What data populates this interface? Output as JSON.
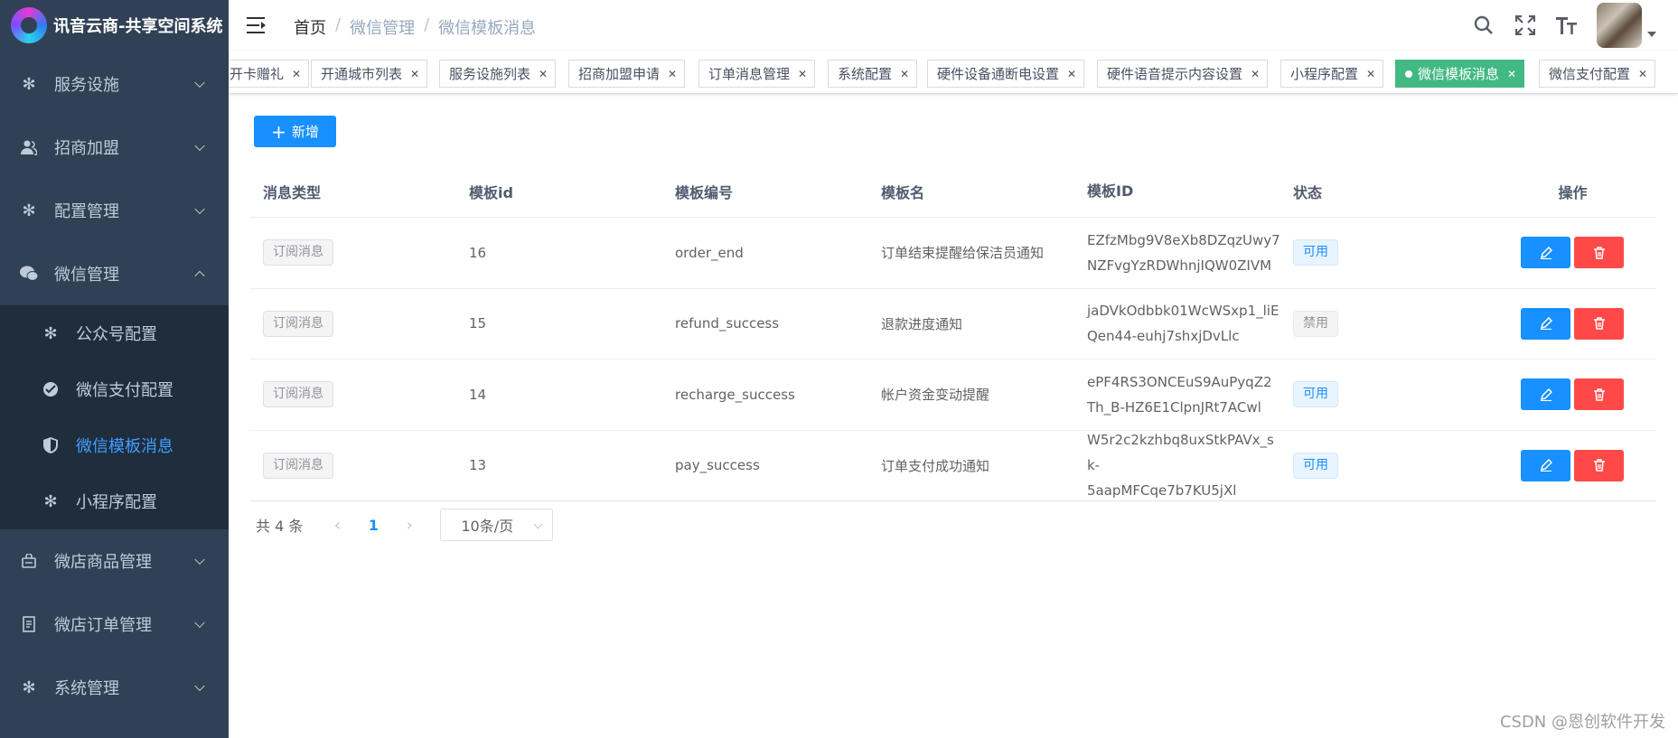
{
  "app": {
    "title": "讯音云商-共享空间系统"
  },
  "sidebar": {
    "items": [
      {
        "label": "服务设施",
        "icon": "gear-icon",
        "expanded": false
      },
      {
        "label": "招商加盟",
        "icon": "user-icon",
        "expanded": false
      },
      {
        "label": "配置管理",
        "icon": "gear-icon",
        "expanded": false
      },
      {
        "label": "微信管理",
        "icon": "wechat-icon",
        "expanded": true
      },
      {
        "label": "微店商品管理",
        "icon": "store-icon",
        "expanded": false
      },
      {
        "label": "微店订单管理",
        "icon": "order-icon",
        "expanded": false
      },
      {
        "label": "系统管理",
        "icon": "gear-icon",
        "expanded": false
      }
    ],
    "sub_items": [
      {
        "label": "公众号配置",
        "icon": "gear-icon"
      },
      {
        "label": "微信支付配置",
        "icon": "pay-icon"
      },
      {
        "label": "微信模板消息",
        "icon": "shield-icon",
        "active": true
      },
      {
        "label": "小程序配置",
        "icon": "gear-icon"
      }
    ]
  },
  "header": {
    "breadcrumb": [
      "首页",
      "微信管理",
      "微信模板消息"
    ]
  },
  "tags": [
    "开卡赠礼",
    "开通城市列表",
    "服务设施列表",
    "招商加盟申请",
    "订单消息管理",
    "系统配置",
    "硬件设备通断电设置",
    "硬件语音提示内容设置",
    "小程序配置",
    "微信模板消息",
    "微信支付配置"
  ],
  "active_tag": "微信模板消息",
  "toolbar": {
    "add_label": "新增"
  },
  "table": {
    "columns": [
      "消息类型",
      "模板id",
      "模板编号",
      "模板名",
      "模板ID",
      "状态",
      "操作"
    ],
    "rows": [
      {
        "type": "订阅消息",
        "id": "16",
        "code": "order_end",
        "name": "订单结束提醒给保洁员通知",
        "template_id": "EZfzMbg9V8eXb8DZqzUwy7NZFvgYzRDWhnjIQW0ZIVM",
        "tid1": "EZfzMbg9V8eXb8DZqzUwy7",
        "tid2": "NZFvgYzRDWhnjIQW0ZIVM",
        "status": "可用"
      },
      {
        "type": "订阅消息",
        "id": "15",
        "code": "refund_success",
        "name": "退款进度通知",
        "template_id": "jaDVkOdbbk01WcWSxp1_liEQen44-euhj7shxjDvLlc",
        "tid1": "jaDVkOdbbk01WcWSxp1_liE",
        "tid2": "Qen44-euhj7shxjDvLlc",
        "status": "禁用"
      },
      {
        "type": "订阅消息",
        "id": "14",
        "code": "recharge_success",
        "name": "帐户资金变动提醒",
        "template_id": "ePF4RS3ONCEuS9AuPyqZ2Th_B-HZ6E1ClpnJRt7ACwl",
        "tid1": "ePF4RS3ONCEuS9AuPyqZ2",
        "tid2": "Th_B-HZ6E1ClpnJRt7ACwl",
        "status": "可用"
      },
      {
        "type": "订阅消息",
        "id": "13",
        "code": "pay_success",
        "name": "订单支付成功通知",
        "template_id": "W5r2c2kzhbq8uxStkPAVx_sk-5aapMFCqe7b7KU5jXl",
        "tid1": "W5r2c2kzhbq8uxStkPAVx_sk-",
        "tid2": "5aapMFCqe7b7KU5jXl",
        "status": "可用"
      }
    ]
  },
  "pagination": {
    "total": "共 4 条",
    "page": "1",
    "size": "10条/页"
  },
  "watermark": "CSDN @恩创软件开发",
  "colors": {
    "sidebar_bg": "#304156",
    "submenu_bg": "#1f2d3d",
    "primary": "#1890ff",
    "danger": "#ff4949",
    "active_tag": "#42b983"
  }
}
